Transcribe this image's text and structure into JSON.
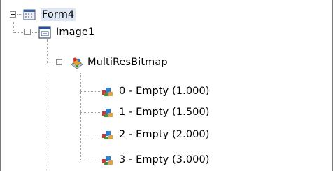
{
  "tree": {
    "root": {
      "label": "Form4",
      "icon": "form-window-icon"
    },
    "image": {
      "label": "Image1",
      "icon": "image-control-icon"
    },
    "bitmap": {
      "label": "MultiResBitmap",
      "icon": "multires-bitmap-icon"
    },
    "items": [
      {
        "label": "0 - Empty (1.000)",
        "icon": "bitmap-item-icon"
      },
      {
        "label": "1 - Empty (1.500)",
        "icon": "bitmap-item-icon"
      },
      {
        "label": "2 - Empty (2.000)",
        "icon": "bitmap-item-icon"
      },
      {
        "label": "3 - Empty (3.000)",
        "icon": "bitmap-item-icon"
      }
    ]
  },
  "colors": {
    "selection": "#dde8f4",
    "connector": "#9a9a9a",
    "border": "#7a7a7a"
  }
}
